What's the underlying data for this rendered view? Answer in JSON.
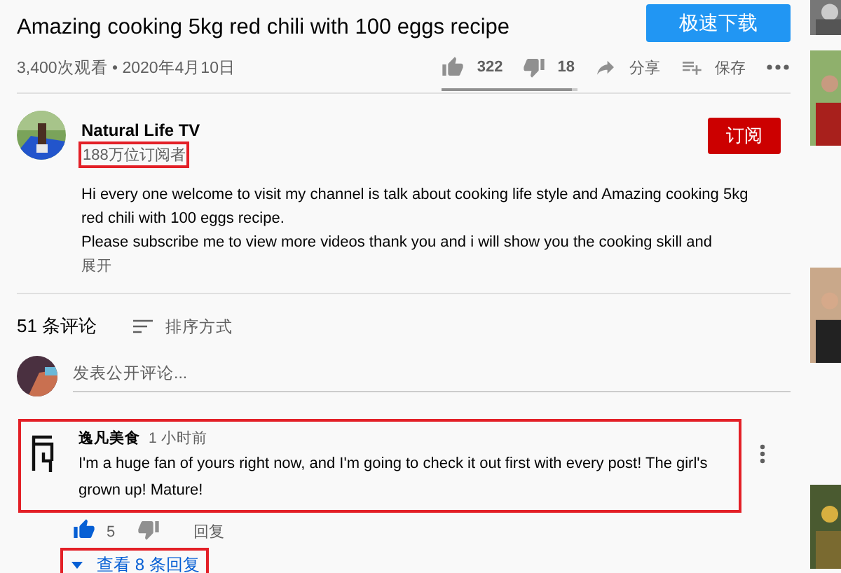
{
  "video": {
    "title": "Amazing cooking 5kg red chili with 100 eggs recipe",
    "meta": "3,400次观看 • 2020年4月10日",
    "download_button": "极速下载",
    "actions": [
      {
        "kind": "like",
        "label": "322"
      },
      {
        "kind": "dislike",
        "label": "18"
      },
      {
        "kind": "share",
        "label": "分享"
      },
      {
        "kind": "save",
        "label": "保存"
      },
      {
        "kind": "more"
      }
    ],
    "rating_bar": {
      "level": 0.95
    }
  },
  "channel": {
    "name": "Natural Life TV",
    "subscribers": "188万位订阅者",
    "subscribers_highlighted": true,
    "subscribe_button": "订阅",
    "description": [
      "Hi every one welcome to visit my channel is talk about cooking life style and Amazing cooking 5kg",
      "red chili with 100 eggs recipe.",
      "Please subscribe me to view more videos thank you and i will show you the cooking skill and"
    ],
    "show_more": "展开"
  },
  "comments": {
    "count": "51 条评论",
    "sort": "排序方式",
    "placeholder": "发表公开评论...",
    "items": [
      {
        "author": "逸凡美食",
        "time": "1 小时前",
        "text": "I'm a huge fan of yours right now, and I'm going to check it out first with every post! The girl's grown up! Mature!",
        "highlighted": true,
        "likes": "5",
        "liked": true,
        "reply": "回复",
        "view_replies": "查看 8 条回复",
        "view_replies_highlighted": true
      }
    ]
  }
}
